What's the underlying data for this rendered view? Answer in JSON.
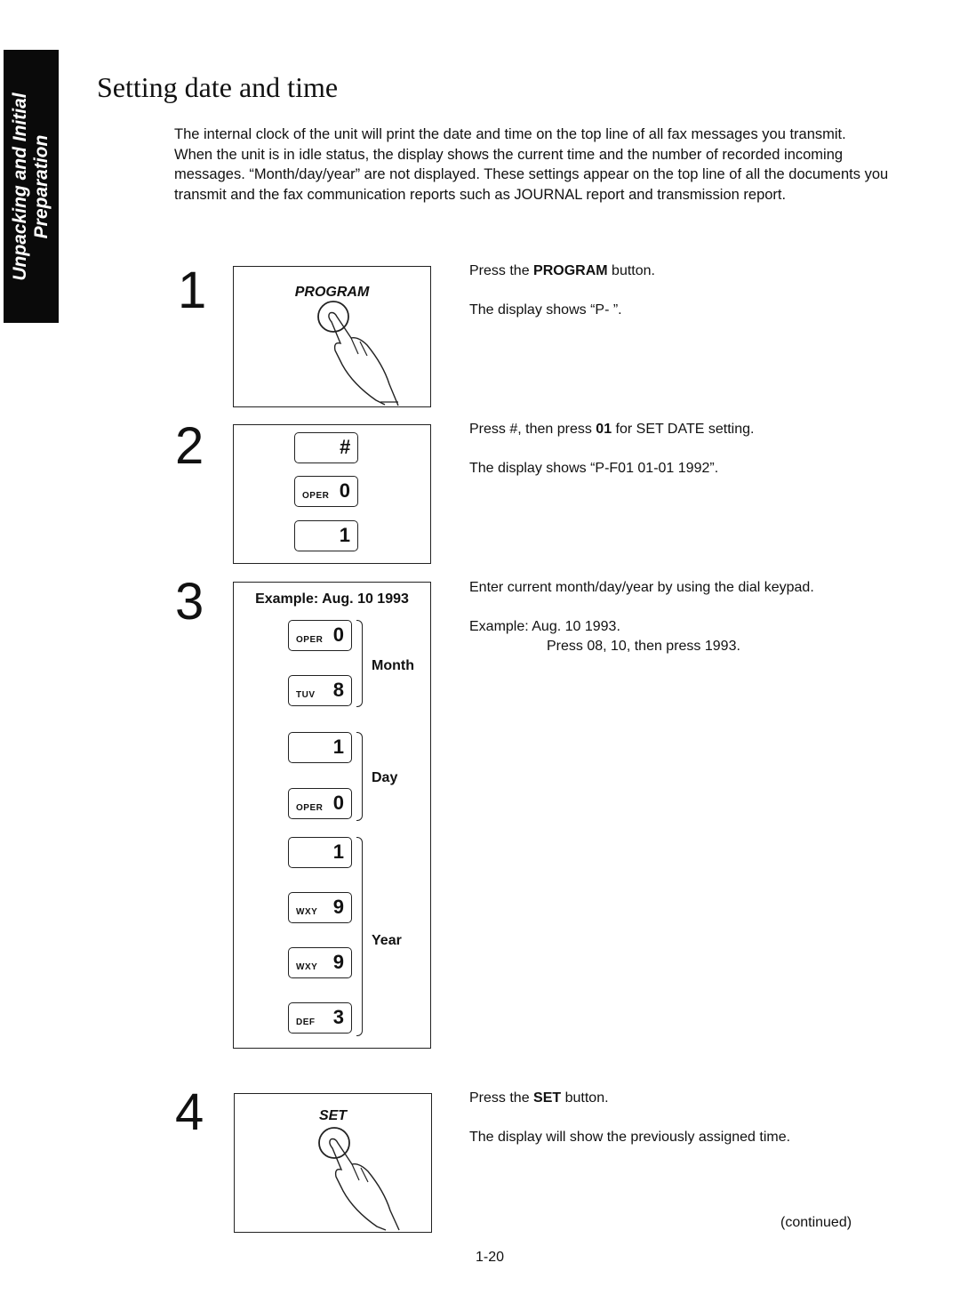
{
  "side_tab": {
    "label": "Unpacking and Initial Preparation"
  },
  "title": "Setting date and time",
  "intro": [
    "The internal clock of the unit will print the date and time on the top line of all fax messages you transmit.",
    "When the unit is in idle status, the display shows the current time and the number of recorded incoming messages. “Month/day/year” are not displayed. These settings appear on the top line of all the documents you transmit and the fax communication reports such as JOURNAL report and transmission report."
  ],
  "steps": [
    {
      "number": "1",
      "figure": {
        "button_label": "PROGRAM",
        "icon": "finger-press-icon"
      },
      "instructions": {
        "pre": "Press the ",
        "bold": "PROGRAM",
        "post": " button.",
        "result": "The display shows “P-  ”."
      }
    },
    {
      "number": "2",
      "figure": {
        "keys": [
          {
            "letters": "",
            "digit": "#"
          },
          {
            "letters": "OPER",
            "digit": "0"
          },
          {
            "letters": "",
            "digit": "1"
          }
        ]
      },
      "instructions": {
        "pre": "Press #, then press ",
        "bold": "01",
        "post": " for SET DATE setting.",
        "result": "The display shows “P-F01  01-01  1992”."
      }
    },
    {
      "number": "3",
      "figure": {
        "example_label": "Example: Aug. 10 1993",
        "keys": [
          {
            "letters": "OPER",
            "digit": "0"
          },
          {
            "letters": "TUV",
            "digit": "8"
          },
          {
            "letters": "",
            "digit": "1"
          },
          {
            "letters": "OPER",
            "digit": "0"
          },
          {
            "letters": "",
            "digit": "1"
          },
          {
            "letters": "WXY",
            "digit": "9"
          },
          {
            "letters": "WXY",
            "digit": "9"
          },
          {
            "letters": "DEF",
            "digit": "3"
          }
        ],
        "groups": {
          "month": "Month",
          "day": "Day",
          "year": "Year"
        }
      },
      "instructions": {
        "line1": "Enter current month/day/year by using the dial keypad.",
        "example_prefix": "Example:  Aug. 10 1993.",
        "example_detail": "Press 08, 10, then press 1993."
      }
    },
    {
      "number": "4",
      "figure": {
        "button_label": "SET",
        "icon": "finger-press-icon"
      },
      "instructions": {
        "pre": "Press the ",
        "bold": "SET",
        "post": " button.",
        "result": "The display will show the previously assigned time."
      }
    }
  ],
  "footer": {
    "continued": "(continued)",
    "page_number": "1-20"
  }
}
